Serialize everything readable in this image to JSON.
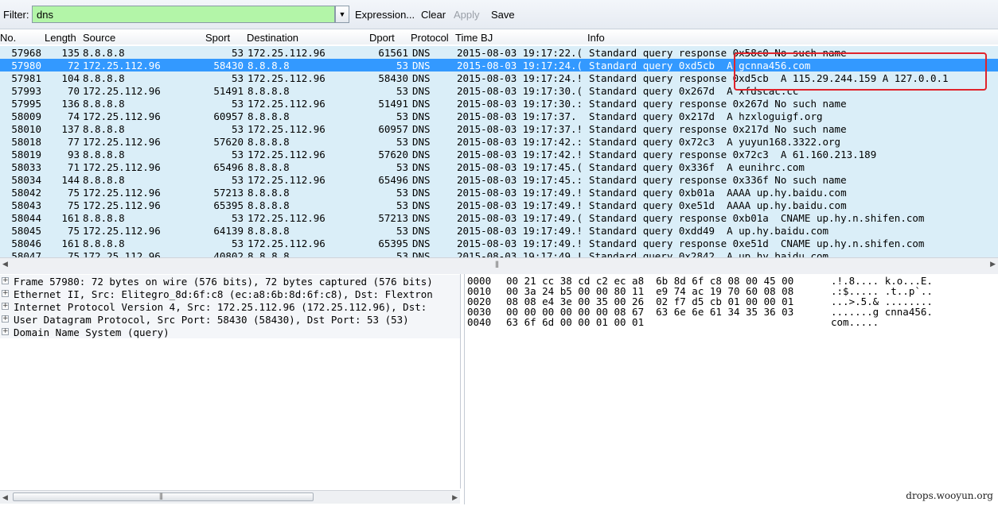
{
  "filter": {
    "label": "Filter:",
    "value": "dns",
    "expression_label": "Expression...",
    "clear_label": "Clear",
    "apply_label": "Apply",
    "save_label": "Save"
  },
  "packet_list": {
    "columns": [
      "No.",
      "Length",
      "Source",
      "Sport",
      "Destination",
      "Dport",
      "Protocol",
      "Time BJ",
      "Info"
    ],
    "rows": [
      {
        "no": "57968",
        "len": "135",
        "src": "8.8.8.8",
        "sport": "53",
        "dst": "172.25.112.96",
        "dport": "61561",
        "proto": "DNS",
        "time": "2015-08-03 19:17:22.(",
        "info": "Standard query response 0x58c0 No such name"
      },
      {
        "no": "57980",
        "len": "72",
        "src": "172.25.112.96",
        "sport": "58430",
        "dst": "8.8.8.8",
        "dport": "53",
        "proto": "DNS",
        "time": "2015-08-03 19:17:24.(",
        "info": "Standard query 0xd5cb  A gcnna456.com"
      },
      {
        "no": "57981",
        "len": "104",
        "src": "8.8.8.8",
        "sport": "53",
        "dst": "172.25.112.96",
        "dport": "58430",
        "proto": "DNS",
        "time": "2015-08-03 19:17:24.!",
        "info": "Standard query response 0xd5cb  A 115.29.244.159 A 127.0.0.1"
      },
      {
        "no": "57993",
        "len": "70",
        "src": "172.25.112.96",
        "sport": "51491",
        "dst": "8.8.8.8",
        "dport": "53",
        "proto": "DNS",
        "time": "2015-08-03 19:17:30.(",
        "info": "Standard query 0x267d  A xfdscac.cc"
      },
      {
        "no": "57995",
        "len": "136",
        "src": "8.8.8.8",
        "sport": "53",
        "dst": "172.25.112.96",
        "dport": "51491",
        "proto": "DNS",
        "time": "2015-08-03 19:17:30.:",
        "info": "Standard query response 0x267d No such name"
      },
      {
        "no": "58009",
        "len": "74",
        "src": "172.25.112.96",
        "sport": "60957",
        "dst": "8.8.8.8",
        "dport": "53",
        "proto": "DNS",
        "time": "2015-08-03 19:17:37.",
        "info": "Standard query 0x217d  A hzxloguigf.org"
      },
      {
        "no": "58010",
        "len": "137",
        "src": "8.8.8.8",
        "sport": "53",
        "dst": "172.25.112.96",
        "dport": "60957",
        "proto": "DNS",
        "time": "2015-08-03 19:17:37.!",
        "info": "Standard query response 0x217d No such name"
      },
      {
        "no": "58018",
        "len": "77",
        "src": "172.25.112.96",
        "sport": "57620",
        "dst": "8.8.8.8",
        "dport": "53",
        "proto": "DNS",
        "time": "2015-08-03 19:17:42.:",
        "info": "Standard query 0x72c3  A yuyun168.3322.org"
      },
      {
        "no": "58019",
        "len": "93",
        "src": "8.8.8.8",
        "sport": "53",
        "dst": "172.25.112.96",
        "dport": "57620",
        "proto": "DNS",
        "time": "2015-08-03 19:17:42.!",
        "info": "Standard query response 0x72c3  A 61.160.213.189"
      },
      {
        "no": "58033",
        "len": "71",
        "src": "172.25.112.96",
        "sport": "65496",
        "dst": "8.8.8.8",
        "dport": "53",
        "proto": "DNS",
        "time": "2015-08-03 19:17:45.(",
        "info": "Standard query 0x336f  A eunihrc.com"
      },
      {
        "no": "58034",
        "len": "144",
        "src": "8.8.8.8",
        "sport": "53",
        "dst": "172.25.112.96",
        "dport": "65496",
        "proto": "DNS",
        "time": "2015-08-03 19:17:45.:",
        "info": "Standard query response 0x336f No such name"
      },
      {
        "no": "58042",
        "len": "75",
        "src": "172.25.112.96",
        "sport": "57213",
        "dst": "8.8.8.8",
        "dport": "53",
        "proto": "DNS",
        "time": "2015-08-03 19:17:49.!",
        "info": "Standard query 0xb01a  AAAA up.hy.baidu.com"
      },
      {
        "no": "58043",
        "len": "75",
        "src": "172.25.112.96",
        "sport": "65395",
        "dst": "8.8.8.8",
        "dport": "53",
        "proto": "DNS",
        "time": "2015-08-03 19:17:49.!",
        "info": "Standard query 0xe51d  AAAA up.hy.baidu.com"
      },
      {
        "no": "58044",
        "len": "161",
        "src": "8.8.8.8",
        "sport": "53",
        "dst": "172.25.112.96",
        "dport": "57213",
        "proto": "DNS",
        "time": "2015-08-03 19:17:49.(",
        "info": "Standard query response 0xb01a  CNAME up.hy.n.shifen.com"
      },
      {
        "no": "58045",
        "len": "75",
        "src": "172.25.112.96",
        "sport": "64139",
        "dst": "8.8.8.8",
        "dport": "53",
        "proto": "DNS",
        "time": "2015-08-03 19:17:49.!",
        "info": "Standard query 0xdd49  A up.hy.baidu.com"
      },
      {
        "no": "58046",
        "len": "161",
        "src": "8.8.8.8",
        "sport": "53",
        "dst": "172.25.112.96",
        "dport": "65395",
        "proto": "DNS",
        "time": "2015-08-03 19:17:49.!",
        "info": "Standard query response 0xe51d  CNAME up.hy.n.shifen.com"
      },
      {
        "no": "58047",
        "len": "75",
        "src": "172.25.112.96",
        "sport": "40802",
        "dst": "8.8.8.8",
        "dport": "53",
        "proto": "DNS",
        "time": "2015-08-03 19:17:49.!",
        "info": "Standard query 0x2842  A up.hy.baidu.com"
      }
    ],
    "selected_index": 1
  },
  "details": [
    "Frame 57980: 72 bytes on wire (576 bits), 72 bytes captured (576 bits)",
    "Ethernet II, Src: Elitegro_8d:6f:c8 (ec:a8:6b:8d:6f:c8), Dst: Flextron",
    "Internet Protocol Version 4, Src: 172.25.112.96 (172.25.112.96), Dst:",
    "User Datagram Protocol, Src Port: 58430 (58430), Dst Port: 53 (53)",
    "Domain Name System (query)"
  ],
  "hex": [
    {
      "offset": "0000",
      "bytes": "00 21 cc 38 cd c2 ec a8  6b 8d 6f c8 08 00 45 00",
      "ascii": ".!.8.... k.o...E."
    },
    {
      "offset": "0010",
      "bytes": "00 3a 24 b5 00 00 80 11  e9 74 ac 19 70 60 08 08",
      "ascii": ".:$..... .t..p`.."
    },
    {
      "offset": "0020",
      "bytes": "08 08 e4 3e 00 35 00 26  02 f7 d5 cb 01 00 00 01",
      "ascii": "...>.5.& ........"
    },
    {
      "offset": "0030",
      "bytes": "00 00 00 00 00 00 08 67  63 6e 6e 61 34 35 36 03",
      "ascii": ".......g cnna456."
    },
    {
      "offset": "0040",
      "bytes": "63 6f 6d 00 00 01 00 01",
      "ascii": "com....."
    }
  ],
  "watermark": "drops.wooyun.org",
  "colors": {
    "filter_bg": "#b3f5a8",
    "row_bg": "#daeef8",
    "selected_bg": "#3399ff",
    "highlight": "#e0232b"
  }
}
